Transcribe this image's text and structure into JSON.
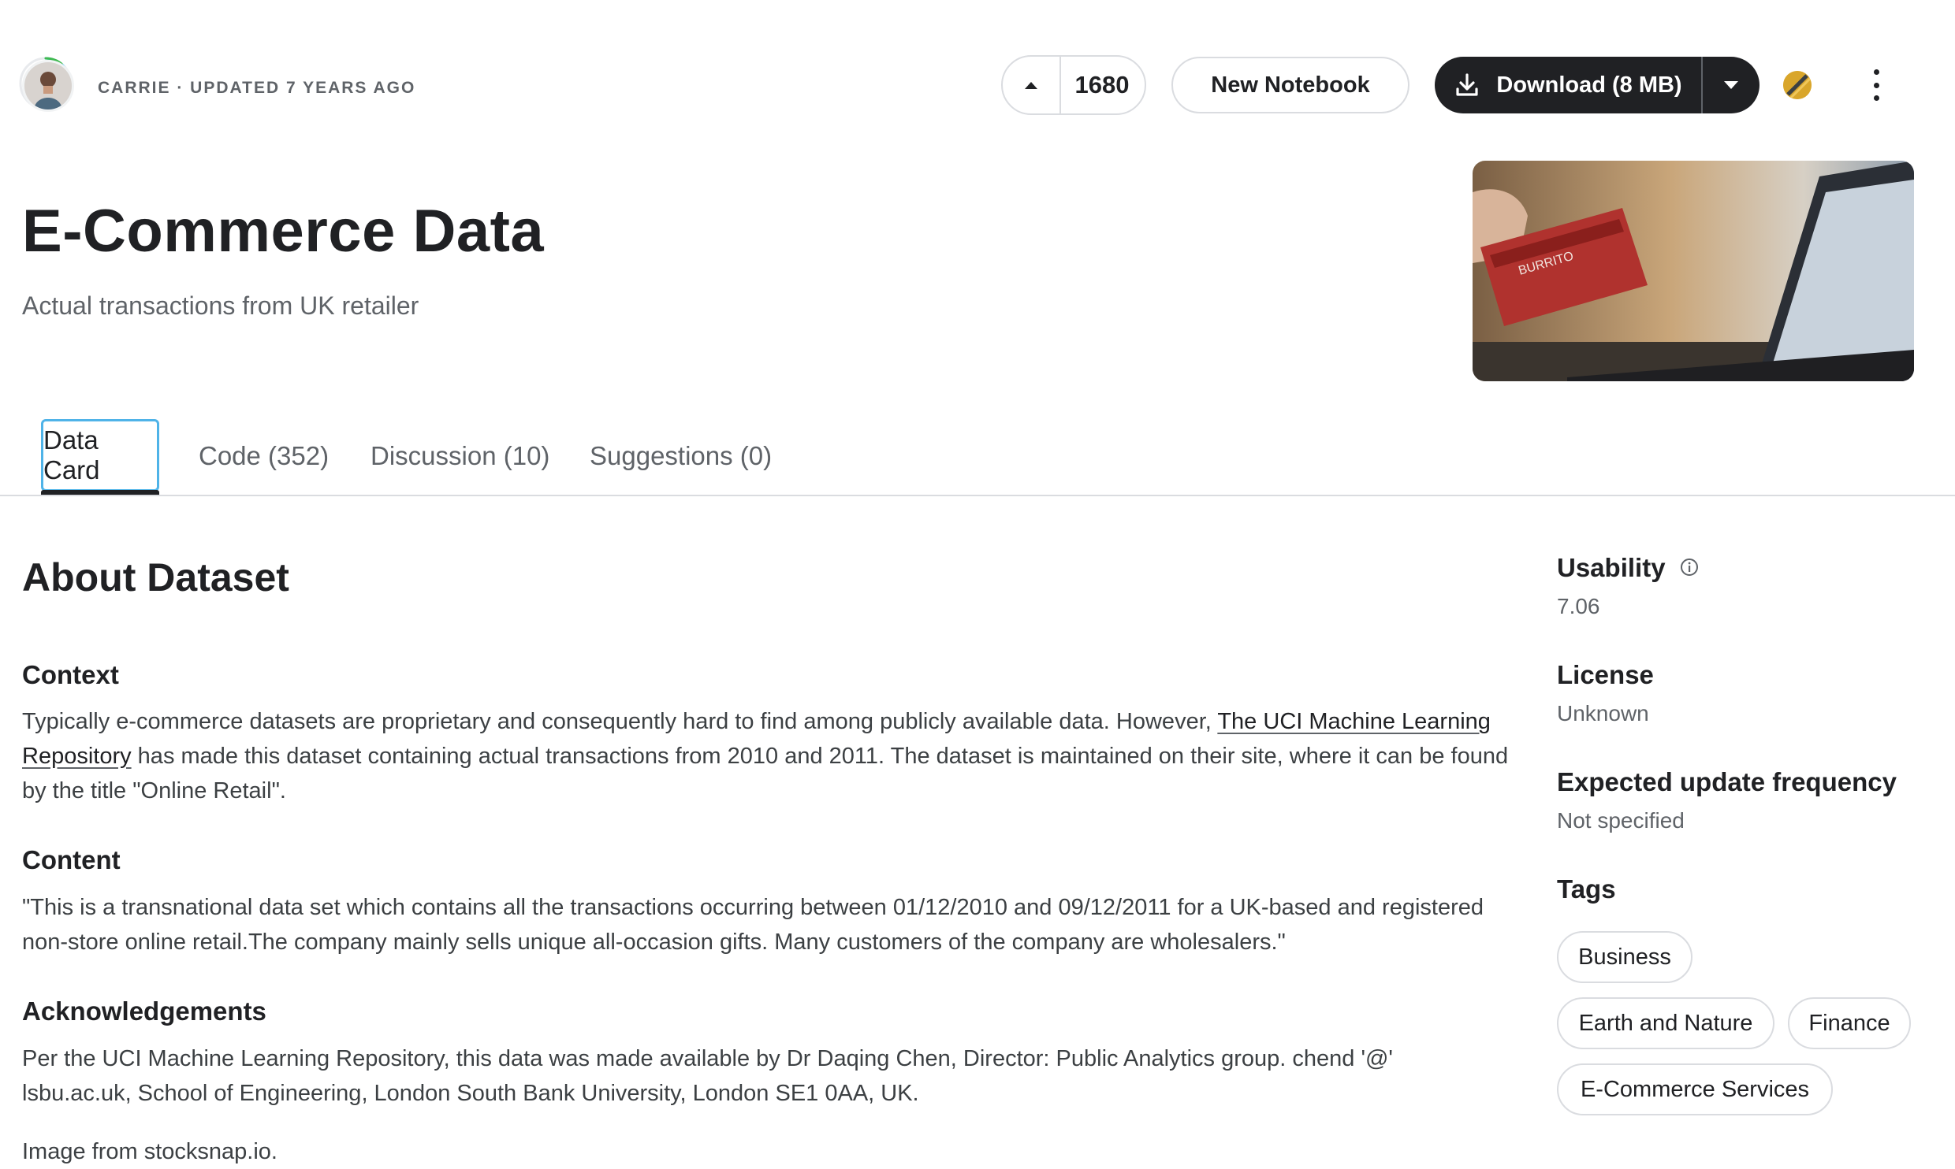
{
  "header": {
    "owner_line": "CARRIE · UPDATED 7 YEARS AGO",
    "vote_count": "1680",
    "new_notebook_label": "New Notebook",
    "download_label": "Download (8 MB)"
  },
  "dataset": {
    "title": "E-Commerce Data",
    "subtitle": "Actual transactions from UK retailer"
  },
  "tabs": [
    {
      "label": "Data Card",
      "active": true
    },
    {
      "label": "Code (352)"
    },
    {
      "label": "Discussion (10)"
    },
    {
      "label": "Suggestions (0)"
    }
  ],
  "about": {
    "heading": "About Dataset",
    "context": {
      "heading": "Context",
      "text_before": "Typically e-commerce datasets are proprietary and consequently hard to find among publicly available data. However, ",
      "link": "The UCI Machine Learning Repository",
      "text_after": " has made this dataset containing actual transactions from 2010 and 2011. The dataset is maintained on their site, where it can be found by the title \"Online Retail\"."
    },
    "content": {
      "heading": "Content",
      "text": "\"This is a transnational data set which contains all the transactions occurring between 01/12/2010 and 09/12/2011 for a UK-based and registered non-store online retail.The company mainly sells unique all-occasion gifts. Many customers of the company are wholesalers.\""
    },
    "acknowledgements": {
      "heading": "Acknowledgements",
      "text": "Per the UCI Machine Learning Repository, this data was made available by Dr Daqing Chen, Director: Public Analytics group. chend '@' lsbu.ac.uk, School of Engineering, London South Bank University, London SE1 0AA, UK.",
      "image_credit": "Image from stocksnap.io."
    }
  },
  "sidebar": {
    "usability_label": "Usability",
    "usability_value": "7.06",
    "license_label": "License",
    "license_value": "Unknown",
    "update_label": "Expected update frequency",
    "update_value": "Not specified",
    "tags_label": "Tags",
    "tags": [
      "Business",
      "Earth and Nature",
      "Finance",
      "E-Commerce Services"
    ]
  },
  "colors": {
    "accent_focus": "#4fb3e8",
    "primary_button": "#202124",
    "medal": "#d9a62b"
  },
  "icons": [
    "arrow-up-icon",
    "download-icon",
    "chevron-down-icon",
    "medal-icon",
    "more-vert-icon",
    "info-icon"
  ]
}
